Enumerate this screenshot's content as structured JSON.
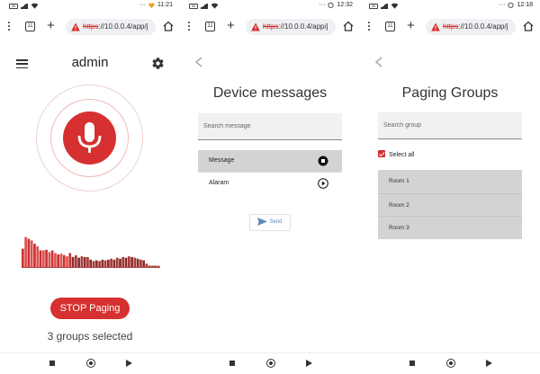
{
  "status": [
    {
      "battery": "30",
      "time": "11:21"
    },
    {
      "battery": "30",
      "time": "12:32"
    },
    {
      "battery": "30",
      "time": "12:18"
    }
  ],
  "browser": {
    "tabs_count": "11",
    "url_scheme": "https",
    "url_rest": "://10.0.0.4/app/j"
  },
  "paging": {
    "title": "admin",
    "stop_label": "STOP Paging",
    "groups_selected": "3 groups selected",
    "waveform_levels": [
      0.55,
      0.9,
      0.85,
      0.8,
      0.7,
      0.62,
      0.5,
      0.5,
      0.52,
      0.45,
      0.5,
      0.42,
      0.38,
      0.4,
      0.36,
      0.32,
      0.42,
      0.3,
      0.35,
      0.28,
      0.32,
      0.3,
      0.3,
      0.22,
      0.18,
      0.2,
      0.18,
      0.22,
      0.2,
      0.22,
      0.25,
      0.22,
      0.28,
      0.25,
      0.3,
      0.28,
      0.32,
      0.3,
      0.28,
      0.25,
      0.22,
      0.2,
      0.1,
      0.04,
      0.04,
      0.04,
      0.04
    ]
  },
  "messages": {
    "title": "Device messages",
    "search_placeholder": "Search message",
    "items": [
      {
        "label": "Message",
        "active": true
      },
      {
        "label": "Alaram",
        "active": false
      }
    ],
    "send_label": "Send"
  },
  "groups": {
    "title": "Paging Groups",
    "search_placeholder": "Search group",
    "select_all_label": "Select all",
    "rooms": [
      "Room 1",
      "Room 2",
      "Room 3"
    ]
  },
  "colors": {
    "accent": "#d63030",
    "send_blue": "#5b8ab8"
  }
}
